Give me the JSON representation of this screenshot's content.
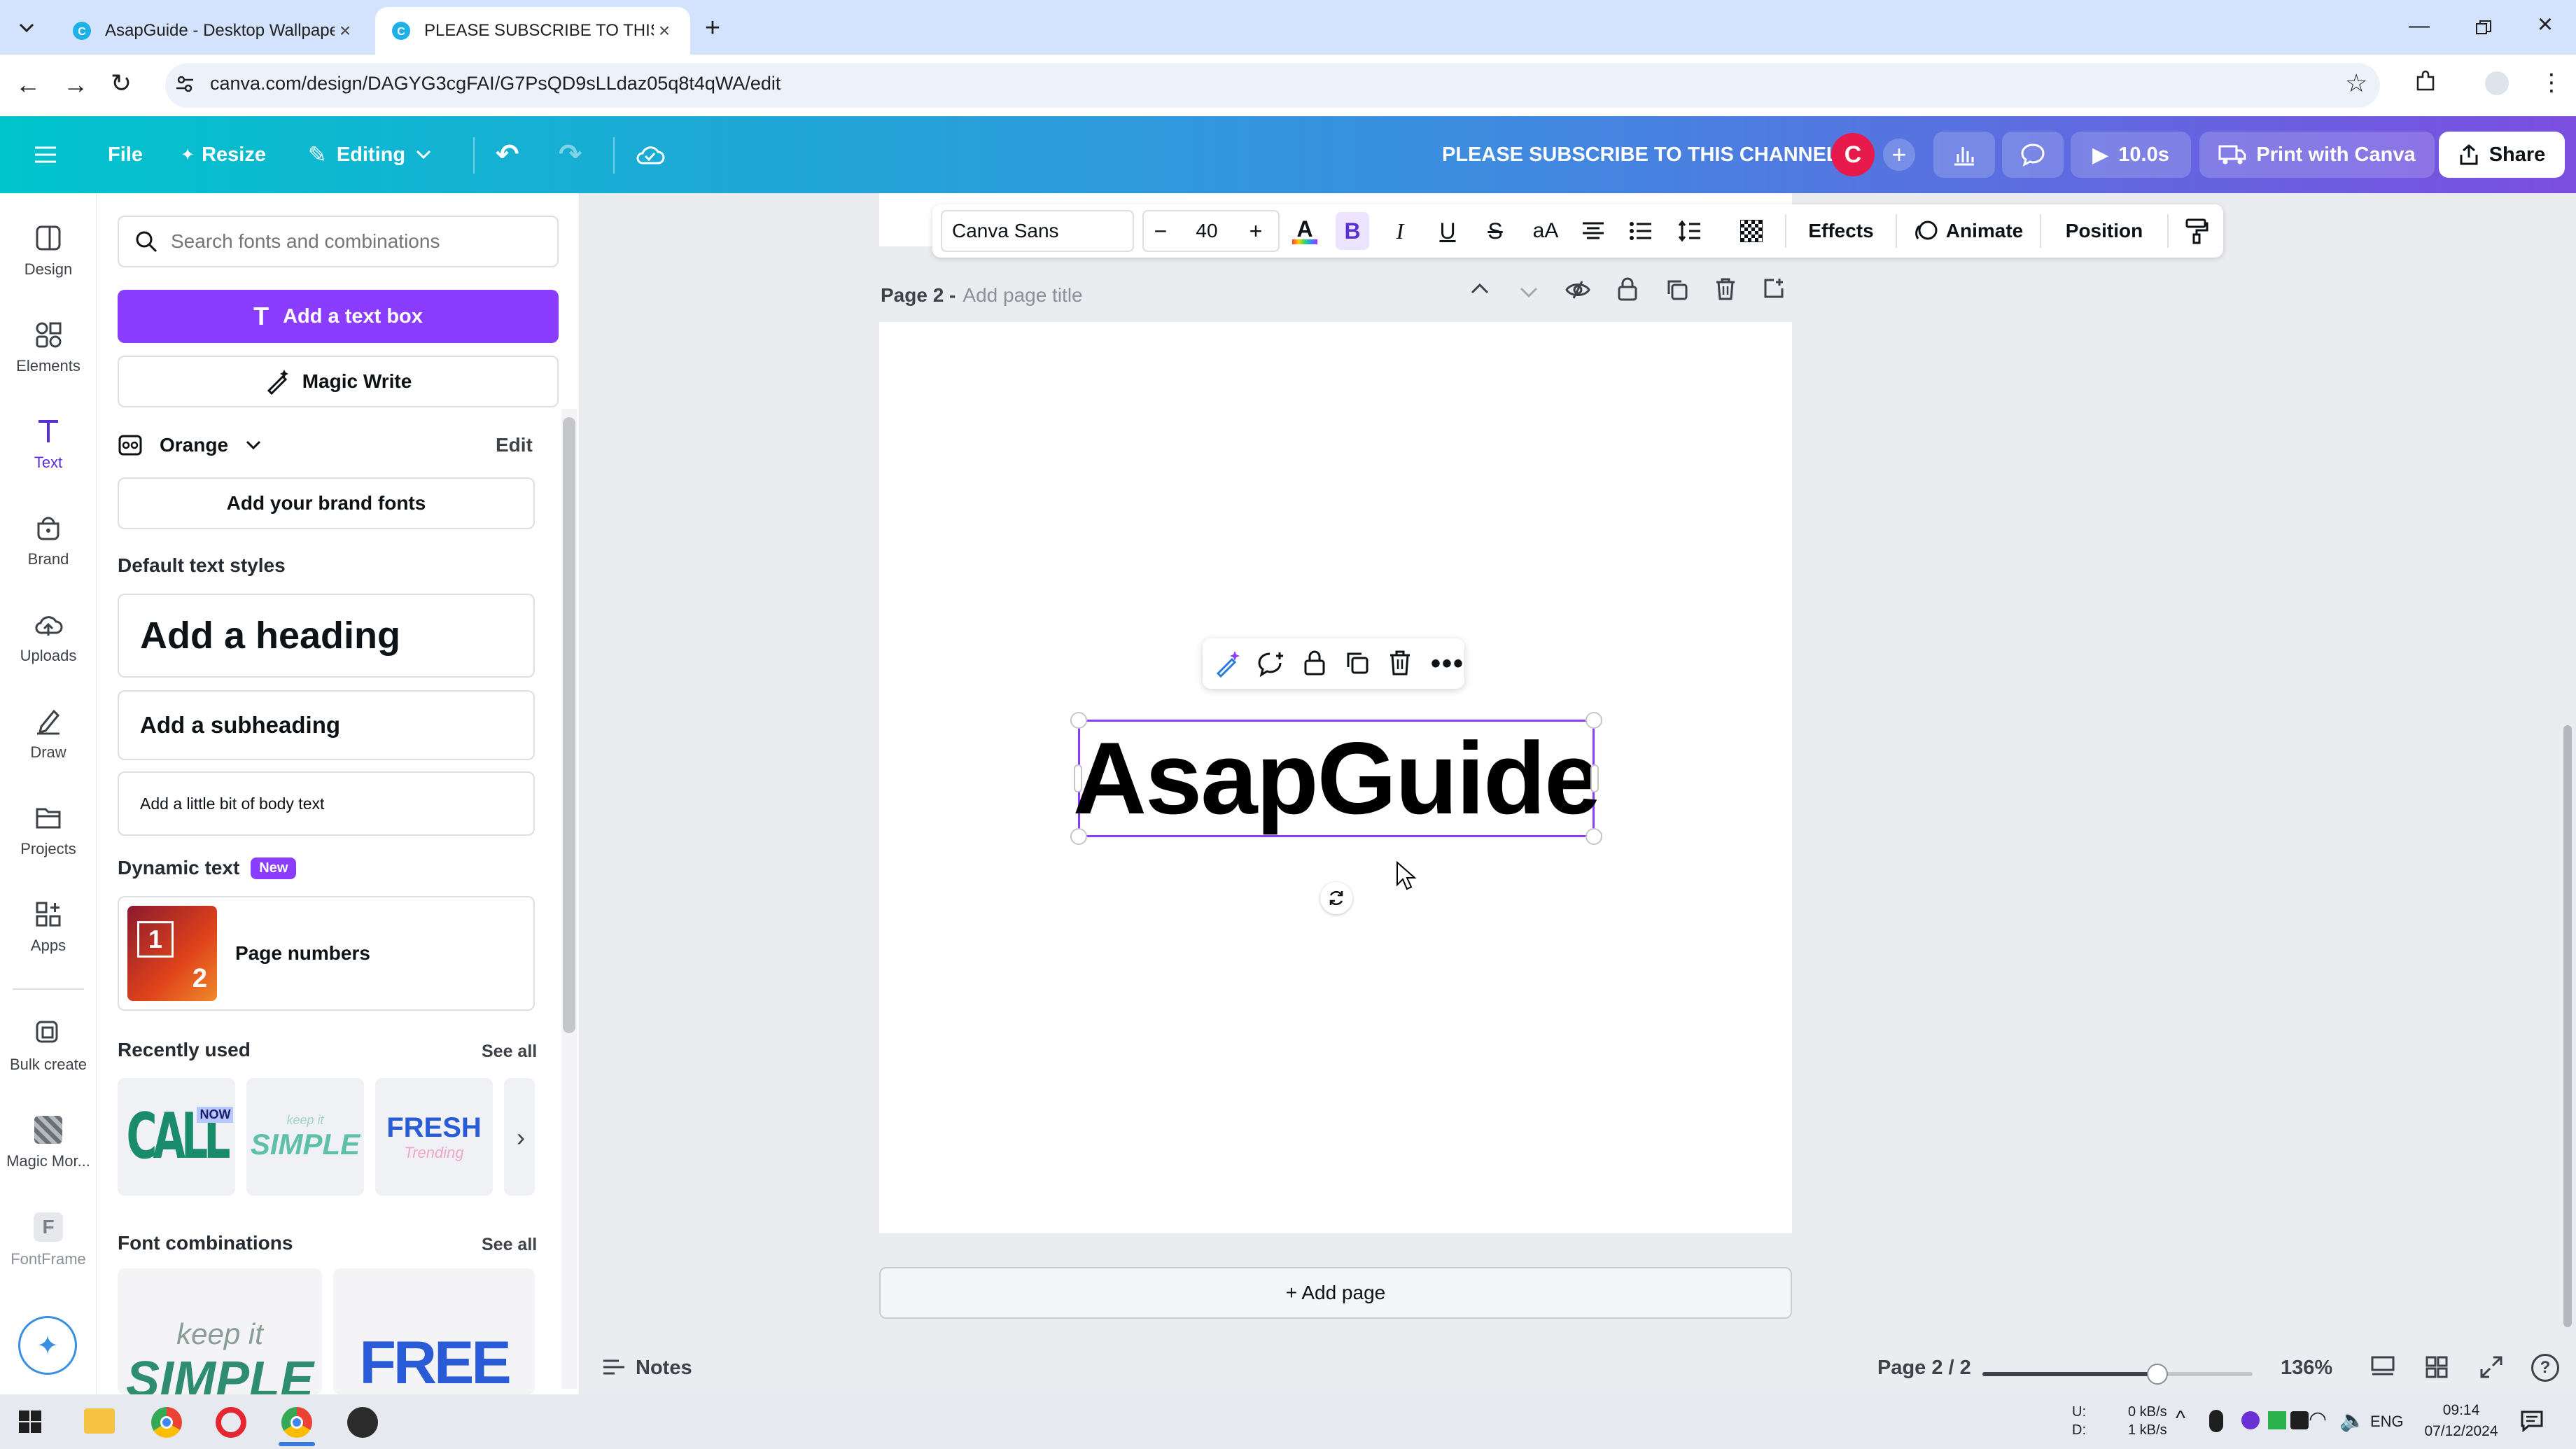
{
  "browser": {
    "tabs": [
      {
        "title": "AsapGuide - Desktop Wallpape",
        "active": false
      },
      {
        "title": "PLEASE SUBSCRIBE TO THIS CH",
        "active": true
      }
    ],
    "url": "canva.com/design/DAGYG3cgFAI/G7PsQD9sLLdaz05q8t4qWA/edit"
  },
  "topbar": {
    "file": "File",
    "resize": "Resize",
    "editing": "Editing",
    "design_title": "PLEASE SUBSCRIBE TO THIS CHANNEL",
    "avatar_letter": "C",
    "timer": "10.0s",
    "print": "Print with Canva",
    "share": "Share"
  },
  "rail": [
    {
      "label": "Design",
      "icon": "design-icon"
    },
    {
      "label": "Elements",
      "icon": "elements-icon"
    },
    {
      "label": "Text",
      "icon": "text-icon"
    },
    {
      "label": "Brand",
      "icon": "brand-icon"
    },
    {
      "label": "Uploads",
      "icon": "uploads-icon"
    },
    {
      "label": "Draw",
      "icon": "draw-icon"
    },
    {
      "label": "Projects",
      "icon": "projects-icon"
    },
    {
      "label": "Apps",
      "icon": "apps-icon"
    },
    {
      "label": "Bulk create",
      "icon": "bulk-create-icon"
    },
    {
      "label": "Magic Mor...",
      "icon": "magic-morph-icon"
    },
    {
      "label": "FontFrame",
      "icon": "fontframe-icon"
    }
  ],
  "panel": {
    "search_placeholder": "Search fonts and combinations",
    "add_text_box": "Add a text box",
    "magic_write": "Magic Write",
    "brand_kit": "Orange",
    "edit": "Edit",
    "add_brand_fonts": "Add your brand fonts",
    "default_styles_title": "Default text styles",
    "heading": "Add a heading",
    "subheading": "Add a subheading",
    "body": "Add a little bit of body text",
    "dynamic_text_title": "Dynamic text",
    "new_badge": "New",
    "page_numbers": "Page numbers",
    "page_numbers_digits": [
      "1",
      "2"
    ],
    "recently_used_title": "Recently used",
    "see_all": "See all",
    "recent": [
      {
        "main": "CALL",
        "sub": "NOW"
      },
      {
        "main": "SIMPLE",
        "sub": "keep it"
      },
      {
        "main": "FRESH",
        "sub": "Trending"
      }
    ],
    "font_combinations_title": "Font combinations",
    "combos": [
      {
        "main": "SIMPLE",
        "sub": "keep it"
      },
      {
        "main": "FREE"
      }
    ]
  },
  "textbar": {
    "font": "Canva Sans",
    "size": "40",
    "minus": "−",
    "plus": "+",
    "effects": "Effects",
    "animate": "Animate",
    "position": "Position"
  },
  "editor": {
    "page_label": "Page 2 -",
    "page_title_placeholder": "Add page title",
    "text": "AsapGuide",
    "add_page": "+ Add page",
    "notes": "Notes",
    "page_count": "Page 2 / 2",
    "zoom": "136%",
    "zoom_level": 0.66
  },
  "taskbar": {
    "net_up": "0 kB/s",
    "net_down": "1 kB/s",
    "net_up_label": "U:",
    "net_down_label": "D:",
    "lang": "ENG",
    "time": "09:14",
    "date": "07/12/2024"
  },
  "colors": {
    "accent_purple": "#8b3dff",
    "avatar_red": "#e8194b",
    "selection": "#8b3dff"
  }
}
